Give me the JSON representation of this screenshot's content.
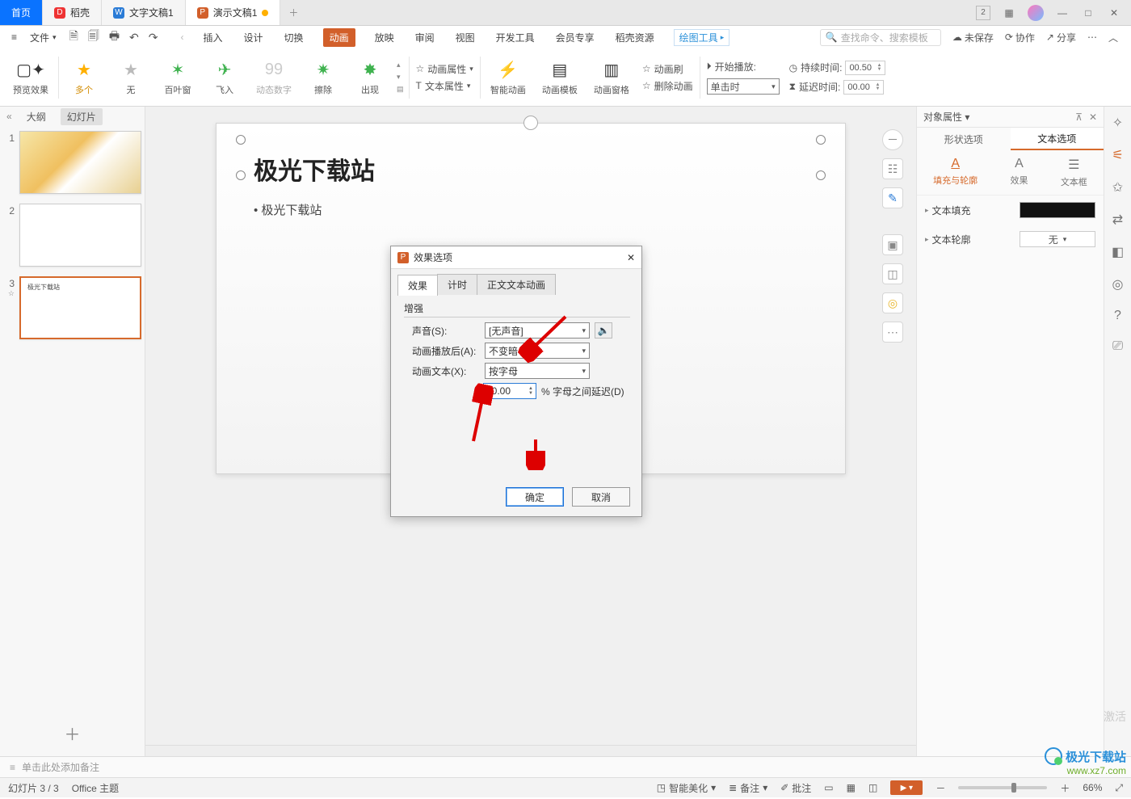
{
  "tabs": {
    "home": "首页",
    "doc1": "稻壳",
    "doc2": "文字文稿1",
    "doc3": "演示文稿1"
  },
  "win": {
    "badge": "2"
  },
  "menu": {
    "file": "文件",
    "insert": "插入",
    "design": "设计",
    "transition": "切换",
    "animation": "动画",
    "slideshow": "放映",
    "review": "审阅",
    "view": "视图",
    "dev": "开发工具",
    "member": "会员专享",
    "resource": "稻壳资源",
    "draw": "绘图工具",
    "search_ph": "查找命令、搜索模板",
    "unsaved": "未保存",
    "coop": "协作",
    "share": "分享"
  },
  "ribbon": {
    "preview": "预览效果",
    "multi": "多个",
    "none": "无",
    "blinds": "百叶窗",
    "flyin": "飞入",
    "dynnum": "动态数字",
    "wipe": "擦除",
    "appear": "出现",
    "anim_prop": "动画属性",
    "text_prop": "文本属性",
    "smart": "智能动画",
    "templates": "动画模板",
    "pane": "动画窗格",
    "painter": "动画刷",
    "delete": "删除动画",
    "start_lbl": "开始播放:",
    "start_val": "单击时",
    "dur_lbl": "持续时间:",
    "dur_val": "00.50",
    "delay_lbl": "延迟时间:",
    "delay_val": "00.00"
  },
  "left": {
    "outline": "大纲",
    "slides": "幻灯片",
    "star": "☆"
  },
  "slide": {
    "title": "极光下载站",
    "bullet": "极光下载站"
  },
  "notes": {
    "placeholder": "单击此处添加备注"
  },
  "rp": {
    "title": "对象属性",
    "t_shape": "形状选项",
    "t_text": "文本选项",
    "s_fill": "填充与轮廓",
    "s_effect": "效果",
    "s_textbox": "文本框",
    "fill": "文本填充",
    "outline": "文本轮廓",
    "outline_val": "无"
  },
  "dialog": {
    "title": "效果选项",
    "tab_effect": "效果",
    "tab_timing": "计时",
    "tab_text": "正文文本动画",
    "group": "增强",
    "sound": "声音(S):",
    "sound_val": "[无声音]",
    "after": "动画播放后(A):",
    "after_val": "不变暗",
    "animtext": "动画文本(X):",
    "animtext_val": "按字母",
    "delay_val": "30.00",
    "delay_suffix": "% 字母之间延迟(D)",
    "ok": "确定",
    "cancel": "取消"
  },
  "status": {
    "slide": "幻灯片 3 / 3",
    "theme": "Office 主题",
    "beautify": "智能美化",
    "notes": "备注",
    "comments": "批注",
    "zoom": "66%"
  },
  "watermark": {
    "name": "极光下载站",
    "url": "www.xz7.com",
    "activate": "激活"
  }
}
